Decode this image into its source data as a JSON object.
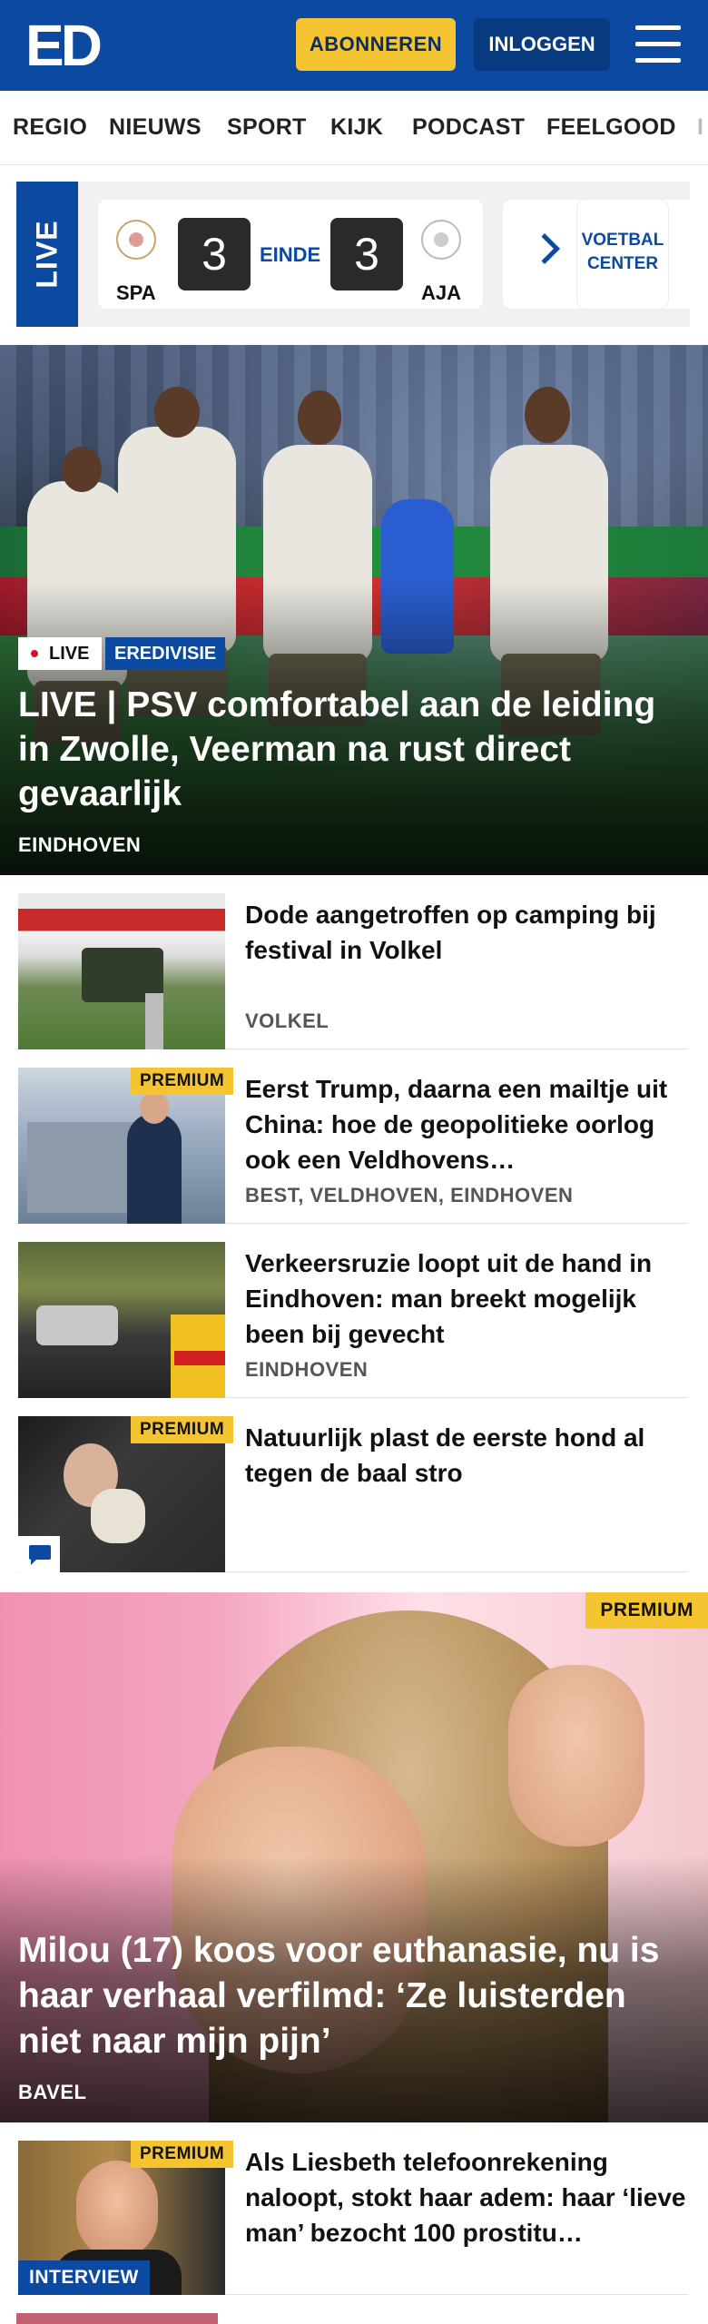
{
  "header": {
    "logo": "ED",
    "subscribe_label": "ABONNEREN",
    "login_label": "INLOGGEN",
    "menu_icon": "hamburger-icon"
  },
  "nav": {
    "items": [
      "REGIO",
      "NIEUWS",
      "SPORT",
      "KIJK",
      "PODCAST",
      "FEELGOOD",
      "I"
    ]
  },
  "live_match": {
    "live_label": "LIVE",
    "home_team": "SPA",
    "home_score": "3",
    "status": "EINDE",
    "away_score": "3",
    "away_team": "AJA",
    "next_icon": "chevron-right-icon",
    "center_label_line1": "VOETBAL",
    "center_label_line2": "CENTER"
  },
  "hero": {
    "tag_live": "LIVE",
    "tag_category": "EREDIVISIE",
    "title": "LIVE | PSV comfortabel aan de leiding in Zwolle, Veerman na rust direct gevaarlijk",
    "location": "EINDHOVEN"
  },
  "articles": [
    {
      "title": "Dode aangetroffen op camping bij festival in Volkel",
      "location": "VOLKEL",
      "premium": false
    },
    {
      "title": "Eerst Trump, daarna een mailtje uit China: hoe de geopolitieke oorlog ook een Veldhovens…",
      "location": "BEST, VELDHOVEN, EINDHOVEN",
      "premium": true
    },
    {
      "title": "Verkeersruzie loopt uit de hand in Eindhoven: man breekt mogelijk been bij gevecht",
      "location": "EINDHOVEN",
      "premium": false
    },
    {
      "title": "Natuurlijk plast de eerste hond al tegen de baal stro",
      "location": "",
      "premium": true
    }
  ],
  "premium_label": "PREMIUM",
  "feature": {
    "badge": "PREMIUM",
    "title": "Milou (17) koos voor euthanasie, nu is haar verhaal verfilmd: ‘Ze luisterden niet naar mijn pijn’",
    "location": "BAVEL"
  },
  "article_last": {
    "badge_premium": "PREMIUM",
    "badge_interview": "INTERVIEW",
    "title": "Als Liesbeth telefoonrekening naloopt, stokt haar adem: haar ‘lieve man’ bezocht 100 prostitu…"
  },
  "colors": {
    "brand_blue": "#0b4aa0",
    "premium_yellow": "#f5c431"
  }
}
